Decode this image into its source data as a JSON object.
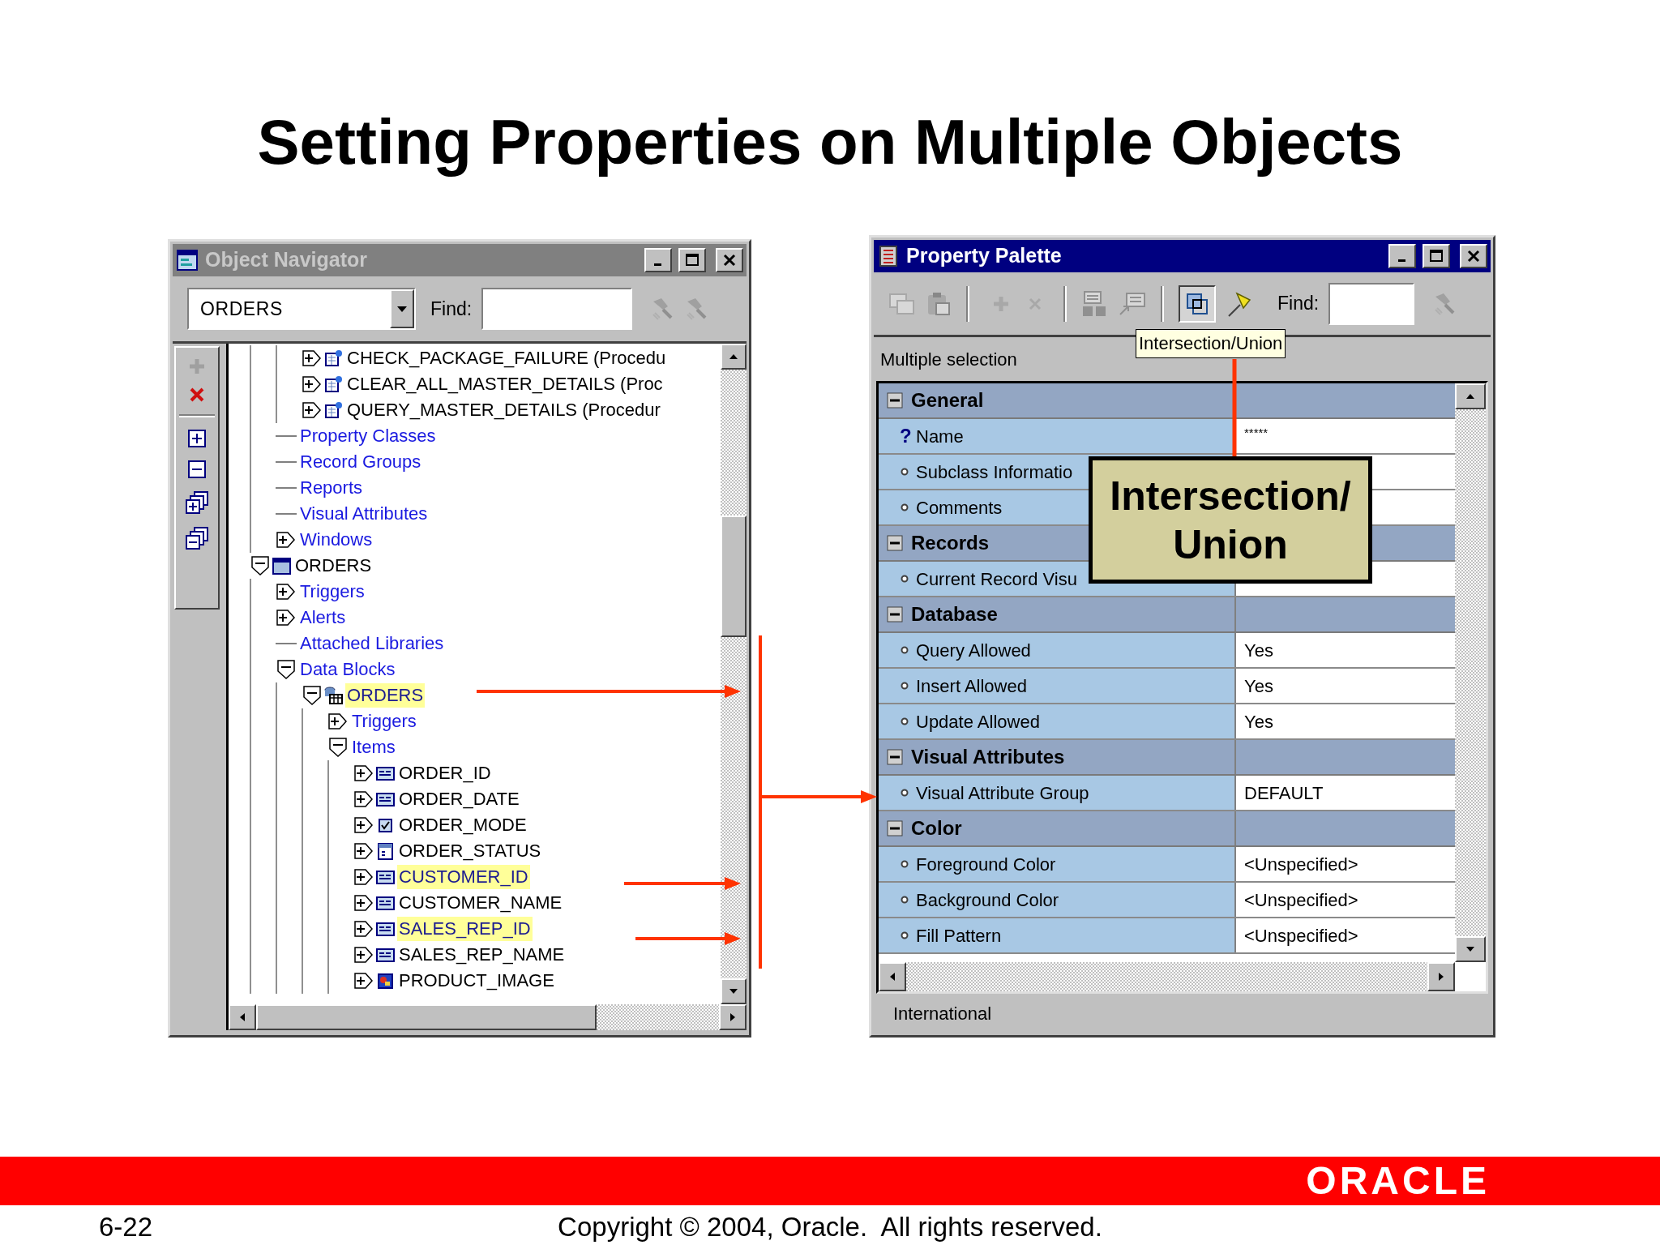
{
  "slide_title": "Setting Properties on Multiple Objects",
  "object_navigator": {
    "title": "Object Navigator",
    "active": false,
    "module_dropdown": "ORDERS",
    "find_label": "Find:",
    "tree": [
      {
        "children": [
          {
            "children": [
              {
                "children": [
                  {
                    "label": "CHECK_PACKAGE_FAILURE (Procedu",
                    "kind": "procedure",
                    "expandable": true,
                    "expanded": false,
                    "selected": false
                  },
                  {
                    "label": "CLEAR_ALL_MASTER_DETAILS (Proc",
                    "kind": "procedure",
                    "expandable": true,
                    "expanded": false,
                    "selected": false
                  },
                  {
                    "label": "QUERY_MASTER_DETAILS (Procedur",
                    "kind": "procedure",
                    "expandable": true,
                    "expanded": false,
                    "selected": false
                  }
                ]
              },
              {
                "label": "Property Classes",
                "kind": "category",
                "expandable": false,
                "selected": false
              },
              {
                "label": "Record Groups",
                "kind": "category",
                "expandable": false,
                "selected": false
              },
              {
                "label": "Reports",
                "kind": "category",
                "expandable": false,
                "selected": false
              },
              {
                "label": "Visual Attributes",
                "kind": "category",
                "expandable": false,
                "selected": false
              },
              {
                "label": "Windows",
                "kind": "category",
                "expandable": true,
                "expanded": false,
                "selected": false
              }
            ]
          },
          {
            "label": "ORDERS",
            "kind": "form",
            "expandable": true,
            "expanded": true,
            "selected": false,
            "children": [
              {
                "label": "Triggers",
                "kind": "category",
                "expandable": true,
                "expanded": false,
                "selected": false
              },
              {
                "label": "Alerts",
                "kind": "category",
                "expandable": true,
                "expanded": false,
                "selected": false
              },
              {
                "label": "Attached Libraries",
                "kind": "category",
                "expandable": false,
                "selected": false
              },
              {
                "label": "Data Blocks",
                "kind": "category",
                "expandable": true,
                "expanded": true,
                "selected": false,
                "children": [
                  {
                    "label": "ORDERS",
                    "kind": "block",
                    "expandable": true,
                    "expanded": true,
                    "selected": true,
                    "children": [
                      {
                        "label": "Triggers",
                        "kind": "category",
                        "expandable": true,
                        "expanded": false,
                        "selected": false
                      },
                      {
                        "label": "Items",
                        "kind": "category",
                        "expandable": true,
                        "expanded": true,
                        "selected": false,
                        "children": [
                          {
                            "label": "ORDER_ID",
                            "kind": "text_item",
                            "expandable": true,
                            "expanded": false,
                            "selected": false
                          },
                          {
                            "label": "ORDER_DATE",
                            "kind": "text_item",
                            "expandable": true,
                            "expanded": false,
                            "selected": false
                          },
                          {
                            "label": "ORDER_MODE",
                            "kind": "check_box",
                            "expandable": true,
                            "expanded": false,
                            "selected": false
                          },
                          {
                            "label": "ORDER_STATUS",
                            "kind": "list_item",
                            "expandable": true,
                            "expanded": false,
                            "selected": false
                          },
                          {
                            "label": "CUSTOMER_ID",
                            "kind": "text_item",
                            "expandable": true,
                            "expanded": false,
                            "selected": true
                          },
                          {
                            "label": "CUSTOMER_NAME",
                            "kind": "text_item",
                            "expandable": true,
                            "expanded": false,
                            "selected": false
                          },
                          {
                            "label": "SALES_REP_ID",
                            "kind": "text_item",
                            "expandable": true,
                            "expanded": false,
                            "selected": true
                          },
                          {
                            "label": "SALES_REP_NAME",
                            "kind": "text_item",
                            "expandable": true,
                            "expanded": false,
                            "selected": false
                          },
                          {
                            "label": "PRODUCT_IMAGE",
                            "kind": "image_item",
                            "expandable": true,
                            "expanded": false,
                            "selected": false
                          }
                        ]
                      }
                    ]
                  }
                ]
              }
            ]
          }
        ]
      }
    ]
  },
  "property_palette": {
    "title": "Property Palette",
    "active": true,
    "find_label": "Find:",
    "intersection_union_pressed": true,
    "context": "Multiple selection",
    "tooltip": "Intersection/Union",
    "sections": [
      {
        "label": "General",
        "expanded": true,
        "properties": [
          {
            "kind": "flagged",
            "marker": "?",
            "name": "Name",
            "value": "*****"
          },
          {
            "kind": "plain",
            "name": "Subclass Informatio"
          },
          {
            "kind": "plain",
            "name": "Comments"
          }
        ]
      },
      {
        "label": "Records",
        "expanded": true,
        "properties": [
          {
            "kind": "plain",
            "name": "Current Record Visu"
          }
        ]
      },
      {
        "label": "Database",
        "expanded": true,
        "properties": [
          {
            "kind": "plain",
            "name": "Query Allowed",
            "value": "Yes"
          },
          {
            "kind": "plain",
            "name": "Insert Allowed",
            "value": "Yes"
          },
          {
            "kind": "plain",
            "name": "Update Allowed",
            "value": "Yes"
          }
        ]
      },
      {
        "label": "Visual Attributes",
        "expanded": true,
        "properties": [
          {
            "kind": "plain",
            "name": "Visual Attribute Group",
            "value": "DEFAULT"
          }
        ]
      },
      {
        "label": "Color",
        "expanded": true,
        "properties": [
          {
            "kind": "plain",
            "name": "Foreground Color",
            "value": "<Unspecified>"
          },
          {
            "kind": "plain",
            "name": "Background Color",
            "value": "<Unspecified>"
          },
          {
            "kind": "plain",
            "name": "Fill Pattern",
            "value": "<Unspecified>"
          }
        ]
      }
    ],
    "status": "International"
  },
  "callout": {
    "text": "Intersection/\nUnion"
  },
  "footer": {
    "logo": "ORACLE",
    "slide_number": "6-22",
    "copyright": "Copyright © 2004, Oracle.  All rights reserved."
  }
}
